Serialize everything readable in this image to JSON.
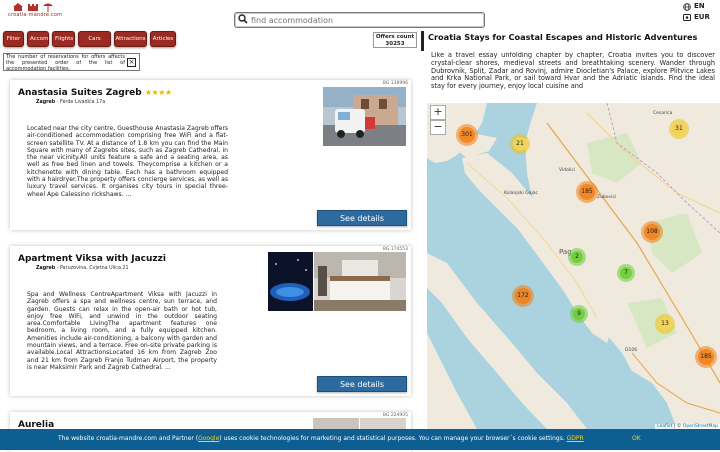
{
  "header": {
    "logo_text": "croatia-mandre.com",
    "search_placeholder": "find accommodation",
    "languages": [
      {
        "icon": "globe-icon",
        "label": "EN"
      },
      {
        "icon": "currency-icon",
        "label": "EUR"
      }
    ]
  },
  "filter_bar": {
    "buttons": [
      "Filter",
      "Accommodation",
      "Flights",
      "Cars",
      "Attractions",
      "Articles"
    ],
    "offers_count_label": "Offers count",
    "offers_count_value": "30253",
    "notice": "The number of reservations for offers affects the presented order of the list of accommodation facilities."
  },
  "listings": [
    {
      "id": "BG.138996",
      "title": "Anastasia Suites Zagreb",
      "stars": "★★★★",
      "city": "Zagreb",
      "address": "Ferde Livadića 17a",
      "description": "Located near the city centre, Guesthouse Anastasia Zagreb offers air-conditioned accommodation comprising free WiFi and a flat-screen satellite TV. At a distance of 1.8 km you can find the Main Square with many of Zagrebs sites, such as Zagreb Cathedral, in the near vicinity.All units feature a safe and a seating area, as well as free bed linen and towels. Theycomprise a kitchen or a kitchenette with dining table. Each has a bathroom equipped with a hairdryer.The property offers concierge services, as well as luxury travel services. It organises city tours in special three-wheel Ape Calessino rickshaws. ...",
      "button": "See details"
    },
    {
      "id": "BG.174553",
      "title": "Apartment Viksa with Jacuzzi",
      "stars": "",
      "city": "Zagreb",
      "address": "Paruzovina, Cvjetna Ulica 21",
      "description": "Spa and Wellness CentreApartment Viksa with Jacuzzi in Zagreb offers a spa and wellness centre, sun terrace, and garden. Guests can relax in the open-air bath or hot tub, enjoy free WiFi, and unwind in the outdoor seating area.Comfortable LivingThe apartment features one bedroom, a living room, and a fully equipped kitchen. Amenities include air-conditioning, a balcony with garden and mountain views, and a terrace. Free on-site private parking is available.Local AttractionsLocated 16 km from Zagreb Zoo and 21 km from Zagreb Franjo Tudman Airport, the property is near Maksimir Park and Zagreb Cathedral. ...",
      "button": "See details"
    },
    {
      "id": "BG.224905",
      "title": "Aurelia"
    }
  ],
  "intro": {
    "title": "Croatia Stays for Coastal Escapes and Historic Adventures",
    "text": "Like a travel essay unfolding chapter by chapter, Croatia invites you to discover crystal-clear shores, medieval streets and breathtaking scenery. Wander through Dubrovnik, Split, Zadar and Rovinj, admire Diocletian's Palace, explore Plitvice Lakes and Krka National Park, or sail toward Hvar and the Adriatic islands. Find the ideal stay for every journey, enjoy local cuisine and"
  },
  "map": {
    "zoom_in": "+",
    "zoom_out": "−",
    "clusters": [
      {
        "count": "301",
        "color": "orange"
      },
      {
        "count": "21",
        "color": "yellow"
      },
      {
        "count": "31",
        "color": "yellow"
      },
      {
        "count": "185",
        "color": "orange"
      },
      {
        "count": "108",
        "color": "orange"
      },
      {
        "count": "2",
        "color": "green"
      },
      {
        "count": "7",
        "color": "green"
      },
      {
        "count": "172",
        "color": "orange"
      },
      {
        "count": "9",
        "color": "green"
      },
      {
        "count": "13",
        "color": "yellow"
      },
      {
        "count": "185",
        "color": "orange"
      }
    ],
    "labels": [
      "Cesarica",
      "Vidalici",
      "Kolanjski Gajac",
      "Zubovici",
      "Pag",
      "D106"
    ],
    "attribution_leaflet": "Leaflet",
    "attribution_sep": " | © ",
    "attribution_osm": "OpenStreetMap"
  },
  "cookie": {
    "text_before": "The website croatia-mandre.com and Partner (",
    "google": "Google",
    "text_after": ") uses cookie technologies for marketing and statistical purposes. You can manage your browser´s cookie settings.",
    "gdpr": "GDPR",
    "ok": "OK"
  },
  "colors": {
    "accent_red": "#9b2a22",
    "button_blue": "#2d6a9f",
    "cookie_bar": "#0d5f92",
    "star_gold": "#f0b400"
  }
}
